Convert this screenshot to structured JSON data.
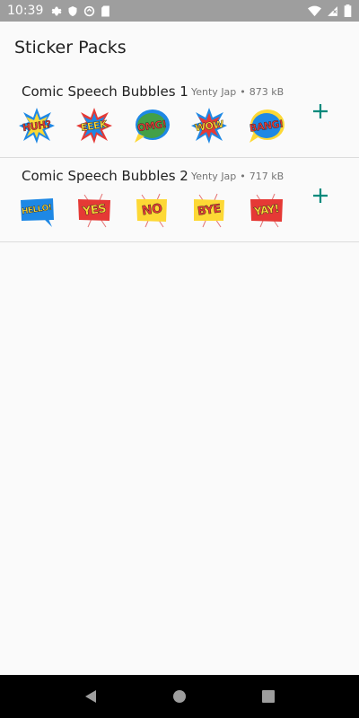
{
  "status_bar": {
    "time": "10:39",
    "left_icons": [
      "settings-icon",
      "shield-icon",
      "data-saver-icon",
      "sd-card-icon"
    ],
    "right_icons": [
      "wifi-icon",
      "signal-icon",
      "battery-icon"
    ]
  },
  "header": {
    "title": "Sticker Packs"
  },
  "packs": [
    {
      "title": "Comic Speech Bubbles 1",
      "publisher": "Yenty Jap",
      "separator": "•",
      "size": "873 kB",
      "stickers": [
        {
          "text": "HUH?",
          "fg": "#e53935",
          "bg": "#fdd835",
          "shape": "burst"
        },
        {
          "text": "EEEK",
          "fg": "#fdd835",
          "bg": "#1e88e5",
          "shape": "burst"
        },
        {
          "text": "OMG!",
          "fg": "#e53935",
          "bg": "#43a047",
          "shape": "cloud"
        },
        {
          "text": "WOW",
          "fg": "#fdd835",
          "bg": "#e53935",
          "shape": "burst"
        },
        {
          "text": "BANG!",
          "fg": "#e53935",
          "bg": "#1e88e5",
          "shape": "cloud"
        }
      ],
      "add_label": "+"
    },
    {
      "title": "Comic Speech Bubbles 2",
      "publisher": "Yenty Jap",
      "separator": "•",
      "size": "717 kB",
      "stickers": [
        {
          "text": "HELLO!",
          "fg": "#fdd835",
          "bg": "#1e88e5",
          "shape": "rect"
        },
        {
          "text": "YES",
          "fg": "#fdd835",
          "bg": "#e53935",
          "shape": "rect"
        },
        {
          "text": "NO",
          "fg": "#e53935",
          "bg": "#fdd835",
          "shape": "rect"
        },
        {
          "text": "BYE",
          "fg": "#e53935",
          "bg": "#fdd835",
          "shape": "rect"
        },
        {
          "text": "YAY!",
          "fg": "#fdd835",
          "bg": "#e53935",
          "shape": "rect"
        }
      ],
      "add_label": "+"
    }
  ],
  "nav_bar": {
    "icons": [
      "back-icon",
      "home-icon",
      "recents-icon"
    ]
  },
  "colors": {
    "accent": "#00897b",
    "status_bar": "#9e9e9e",
    "nav_bar": "#000000",
    "background": "#fafafa"
  }
}
